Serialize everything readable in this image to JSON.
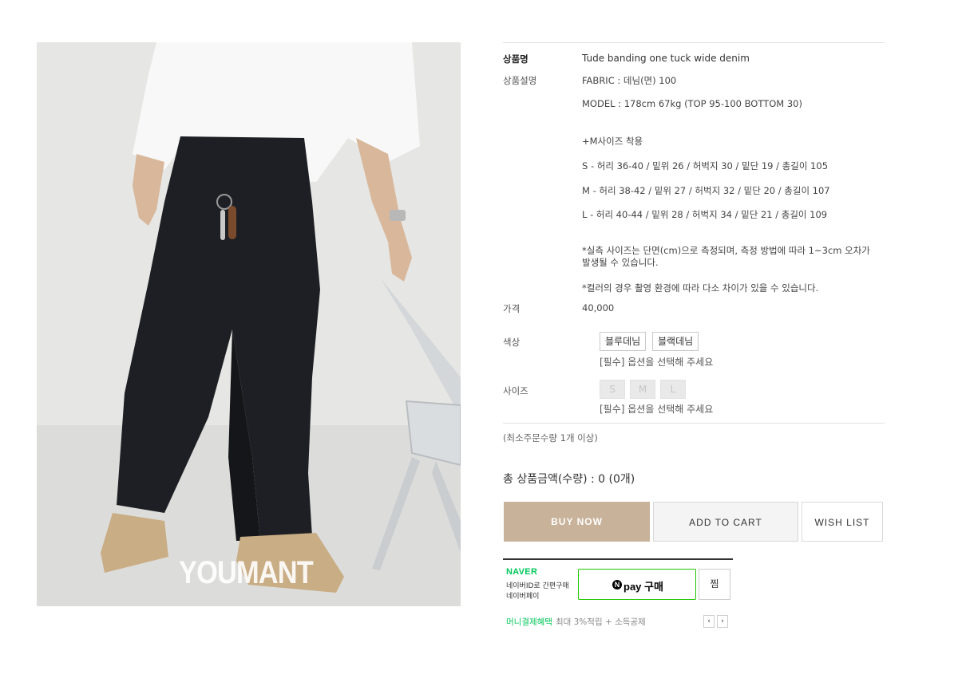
{
  "product": {
    "watermark": "YOUMANT",
    "name_label": "상품명",
    "name": "Tude banding one tuck wide denim",
    "desc_label": "상품설명",
    "desc_lines": [
      "FABRIC : 데님(면) 100",
      "MODEL : 178cm 67kg (TOP 95-100 BOTTOM 30)",
      "+M사이즈 착용",
      "S - 허리 36-40 / 밑위 26 / 허벅지 30 / 밑단 19 / 총길이 105",
      "M - 허리 38-42 / 밑위 27 / 허벅지 32 / 밑단 20 / 총길이 107",
      "L - 허리 40-44 / 밑위 28 / 허벅지 34 / 밑단 21 / 총길이 109",
      "*실측 사이즈는 단면(cm)으로 측정되며, 측정 방법에 따라 1~3cm 오차가 발생될 수 있습니다.",
      "*컬러의 경우 촬영 환경에 따라 다소 차이가 있을 수 있습니다."
    ],
    "price_label": "가격",
    "price": "40,000"
  },
  "options": {
    "color_label": "색상",
    "colors": [
      "블루데님",
      "블랙데님"
    ],
    "color_required": "[필수] 옵션을 선택해 주세요",
    "size_label": "사이즈",
    "sizes": [
      "S",
      "M",
      "L"
    ],
    "size_required": "[필수] 옵션을 선택해 주세요"
  },
  "min_order": "(최소주문수량 1개 이상)",
  "total": "총 상품금액(수량) : 0 (0개)",
  "actions": {
    "buy_now": "BUY NOW",
    "add_to_cart": "ADD TO CART",
    "wish_list": "WISH LIST"
  },
  "npay": {
    "brand": "NAVER",
    "sub_line1": "네이버ID로 간편구매",
    "sub_line2": "네이버페이",
    "n_mark": "N",
    "button_label": "pay 구매",
    "zzim": "찜",
    "benefit_highlight": "머니결제혜택",
    "benefit_text": "최대 3%적립 + 소득공제",
    "prev": "‹",
    "next": "›"
  }
}
